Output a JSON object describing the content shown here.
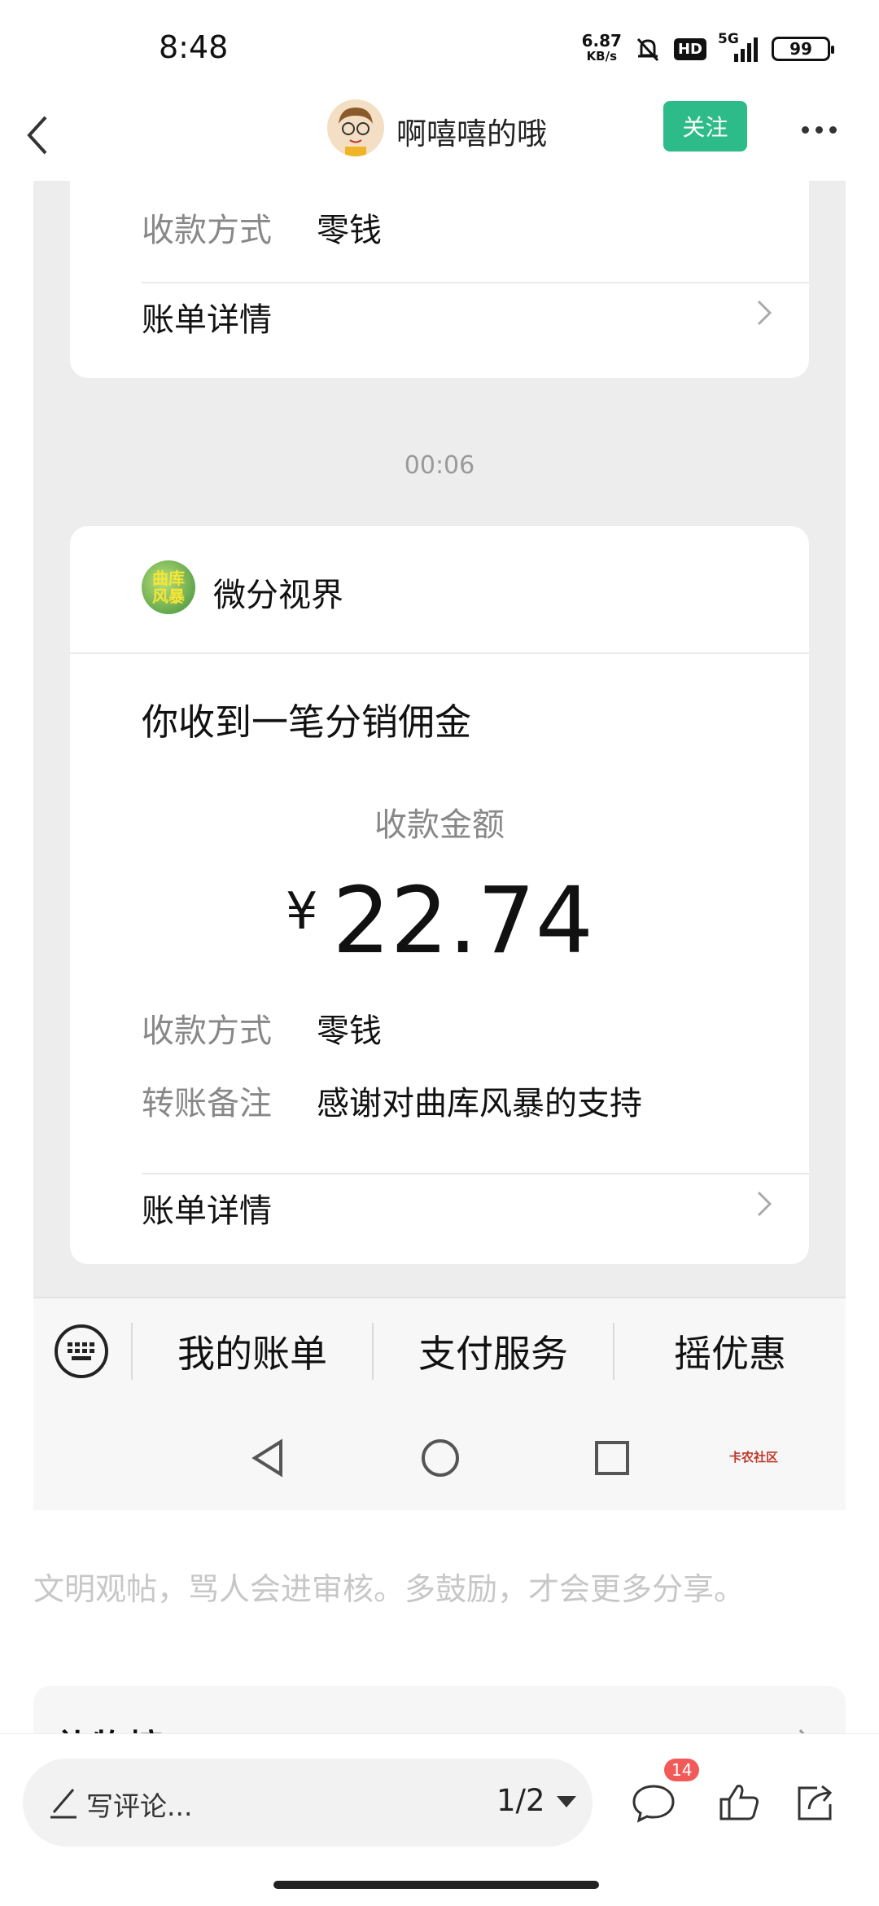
{
  "status_bar": {
    "time": "8:48",
    "net_speed_value": "6.87",
    "net_speed_unit": "KB/s",
    "hd": "HD",
    "network": "5G",
    "battery": "99"
  },
  "post_header": {
    "username": "啊嘻嘻的哦",
    "follow_label": "关注"
  },
  "screenshot": {
    "top_card": {
      "method_label": "收款方式",
      "method_value": "零钱",
      "bill_detail_label": "账单详情"
    },
    "timestamp": "00:06",
    "main_card": {
      "mp_logo_text": "曲库风暴",
      "mp_name": "微分视界",
      "title": "你收到一笔分销佣金",
      "amount_label": "收款金额",
      "currency": "¥",
      "amount": "22.74",
      "method_label": "收款方式",
      "method_value": "零钱",
      "note_label": "转账备注",
      "note_value": "感谢对曲库风暴的支持",
      "bill_detail_label": "账单详情"
    },
    "menu": {
      "items": [
        "我的账单",
        "支付服务",
        "摇优惠"
      ]
    },
    "watermark": "卡农社区"
  },
  "hint_text": "文明观帖，骂人会进审核。多鼓励，才会更多分享。",
  "gift_section_title": "礼物榜",
  "bottom_bar": {
    "comment_placeholder": "写评论...",
    "page_indicator": "1/2",
    "comment_count": "14"
  },
  "colors": {
    "accent": "#2dbb8a",
    "badge": "#f25a5a",
    "chat_bg": "#ededed"
  }
}
